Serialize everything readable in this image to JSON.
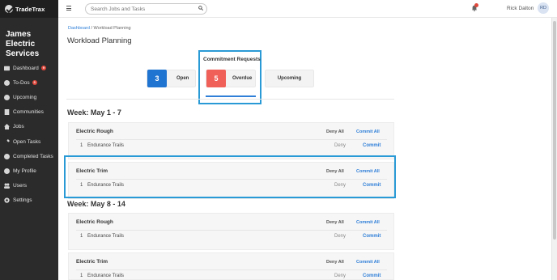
{
  "app": {
    "name": "TradeTrax",
    "company": "James Electric Services"
  },
  "sidebar": {
    "items": [
      {
        "label": "Dashboard",
        "icon": "dashboard-icon",
        "badge": "9"
      },
      {
        "label": "To-Dos",
        "icon": "check-circle-icon",
        "badge": "3"
      },
      {
        "label": "Upcoming",
        "icon": "check-circle-icon"
      },
      {
        "label": "Communities",
        "icon": "building-icon"
      },
      {
        "label": "Jobs",
        "icon": "home-icon"
      },
      {
        "label": "Open Tasks",
        "icon": "wrench-icon"
      },
      {
        "label": "Completed Tasks",
        "icon": "check-circle-icon"
      },
      {
        "label": "My Profile",
        "icon": "user-icon"
      },
      {
        "label": "Users",
        "icon": "users-icon"
      },
      {
        "label": "Settings",
        "icon": "gear-icon"
      }
    ]
  },
  "topbar": {
    "search_placeholder": "Search Jobs and Tasks",
    "user_name": "Rick Dalton",
    "user_initials": "RD"
  },
  "breadcrumb": {
    "link": "Dashboard",
    "separator": " / ",
    "current": "Workload Planning"
  },
  "page_title": "Workload Planning",
  "commitment": {
    "label": "Commitment Requests",
    "cards": [
      {
        "count": "3",
        "label": "Open",
        "color": "#1f73d1"
      },
      {
        "count": "5",
        "label": "Overdue",
        "color": "#f06058"
      },
      {
        "count": "",
        "label": "Upcoming",
        "color": ""
      }
    ]
  },
  "weeks": [
    {
      "title": "Week: May 1 - 7",
      "tasks": [
        {
          "name": "Electric Rough",
          "deny_all": "Deny All",
          "commit_all": "Commit All",
          "rows": [
            {
              "num": "1",
              "job": "Endurance Trails",
              "deny": "Deny",
              "commit": "Commit"
            }
          ]
        },
        {
          "name": "Electric Trim",
          "deny_all": "Deny All",
          "commit_all": "Commit All",
          "rows": [
            {
              "num": "1",
              "job": "Endurance Trails",
              "deny": "Deny",
              "commit": "Commit"
            }
          ]
        }
      ]
    },
    {
      "title": "Week: May 8 - 14",
      "tasks": [
        {
          "name": "Electric Rough",
          "deny_all": "Deny All",
          "commit_all": "Commit All",
          "rows": [
            {
              "num": "1",
              "job": "Endurance Trails",
              "deny": "Deny",
              "commit": "Commit"
            }
          ]
        },
        {
          "name": "Electric Trim",
          "deny_all": "Deny All",
          "commit_all": "Commit All",
          "rows": [
            {
              "num": "1",
              "job": "Endurance Trails",
              "deny": "Deny",
              "commit": "Commit"
            }
          ]
        }
      ]
    }
  ]
}
